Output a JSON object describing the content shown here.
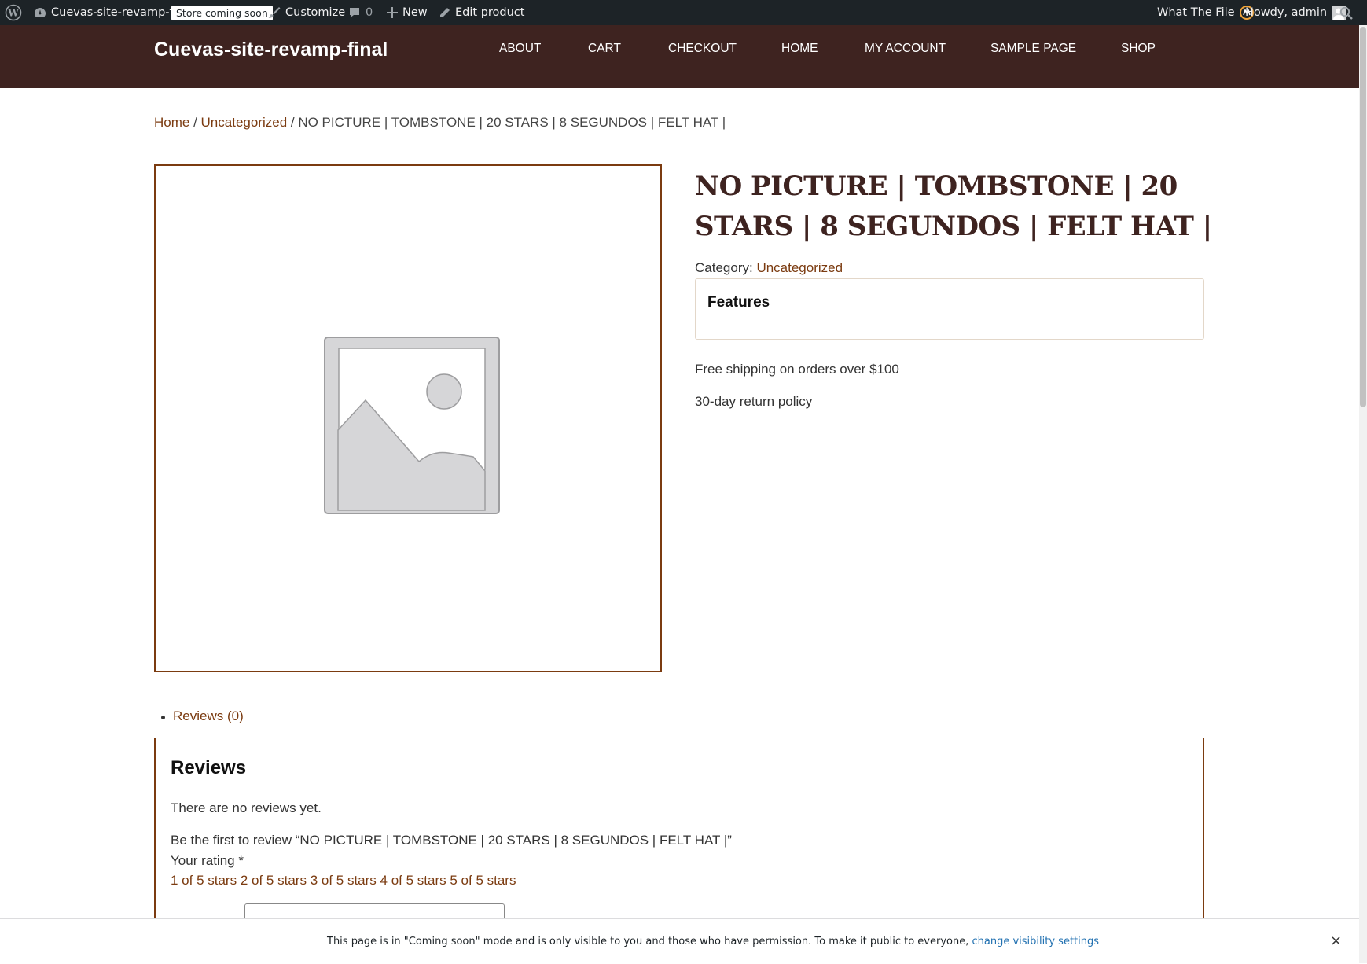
{
  "admin_bar": {
    "site_name": "Cuevas-site-revamp-final",
    "store_badge": "Store coming soon",
    "customize": "Customize",
    "comments_count": "0",
    "new": "New",
    "edit_product": "Edit product",
    "what_the_file": "What The File",
    "howdy": "Howdy, admin"
  },
  "header": {
    "site_title": "Cuevas-site-revamp-final",
    "nav": [
      "ABOUT",
      "CART",
      "CHECKOUT",
      "HOME",
      "MY ACCOUNT",
      "SAMPLE PAGE",
      "SHOP"
    ]
  },
  "breadcrumb": {
    "home": "Home",
    "sep1": " / ",
    "category": "Uncategorized",
    "sep2": " / ",
    "current": "NO PICTURE | TOMBSTONE | 20 STARS | 8 SEGUNDOS | FELT HAT |"
  },
  "product": {
    "title": "NO PICTURE | TOMBSTONE | 20 STARS | 8 SEGUNDOS | FELT HAT |",
    "category_label": "Category: ",
    "category_value": "Uncategorized",
    "features_title": "Features",
    "shipping": "Free shipping on orders over $100",
    "returns": "30-day return policy"
  },
  "tabs": {
    "reviews_tab": "Reviews (0)"
  },
  "reviews": {
    "title": "Reviews",
    "none": "There are no reviews yet.",
    "be_first": "Be the first to review “NO PICTURE | TOMBSTONE | 20 STARS | 8 SEGUNDOS | FELT HAT |”",
    "your_rating": "Your rating *",
    "stars": [
      "1 of 5 stars",
      "2 of 5 stars",
      "3 of 5 stars",
      "4 of 5 stars",
      "5 of 5 stars"
    ]
  },
  "notice": {
    "text": "This page is in \"Coming soon\" mode and is only visible to you and those who have permission. To make it public to everyone, ",
    "link": "change visibility settings",
    "close": "×"
  },
  "colors": {
    "admin_bar": "#1d2327",
    "header": "#3e2320",
    "accent": "#7b3b10",
    "link_blue": "#2271b1"
  }
}
